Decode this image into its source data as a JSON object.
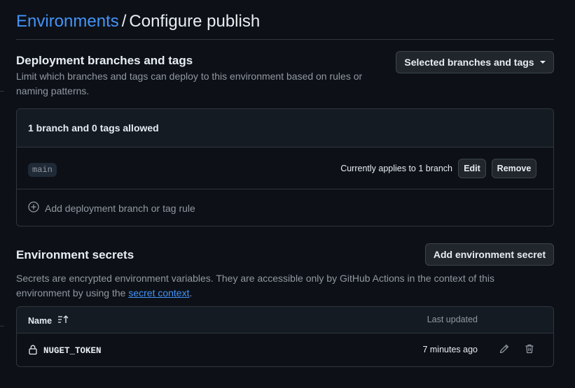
{
  "breadcrumb": {
    "link": "Environments",
    "separator": "/",
    "title": "Configure publish"
  },
  "deployment": {
    "heading": "Deployment branches and tags",
    "description": "Limit which branches and tags can deploy to this environment based on rules or naming patterns.",
    "policy_select": "Selected branches and tags",
    "summary": "1 branch and 0 tags allowed",
    "rules": [
      {
        "name": "main",
        "applies": "Currently applies to 1 branch",
        "edit_label": "Edit",
        "remove_label": "Remove"
      }
    ],
    "add_rule": "Add deployment branch or tag rule"
  },
  "secrets": {
    "heading": "Environment secrets",
    "add_button": "Add environment secret",
    "description_prefix": "Secrets are encrypted environment variables. They are accessible only by GitHub Actions in the context of this environment by using the ",
    "description_link": "secret context",
    "description_suffix": ".",
    "columns": {
      "name": "Name",
      "updated": "Last updated"
    },
    "rows": [
      {
        "name": "NUGET_TOKEN",
        "updated": "7 minutes ago"
      }
    ]
  },
  "colors": {
    "background": "#0d1117",
    "link": "#4493f8",
    "border": "#30363d",
    "muted": "#9198a1"
  }
}
